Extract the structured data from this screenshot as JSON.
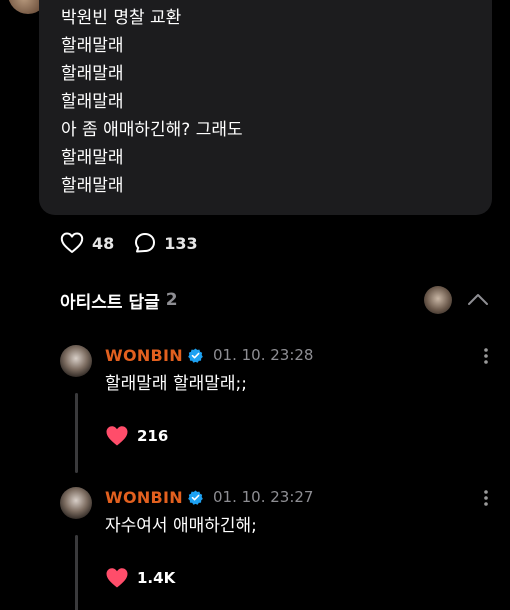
{
  "post": {
    "lines": [
      "박원빈 명찰 교환",
      "할래말래",
      "할래말래",
      "할래말래",
      "아 좀 애매하긴해? 그래도",
      "할래말래",
      "할래말래"
    ],
    "likes": "48",
    "comments": "133"
  },
  "replies_section": {
    "title": "아티스트 답글",
    "count": "2"
  },
  "replies": [
    {
      "author": "WONBIN",
      "timestamp": "01. 10. 23:28",
      "text": "할래말래 할래말래;;",
      "likes": "216"
    },
    {
      "author": "WONBIN",
      "timestamp": "01. 10. 23:27",
      "text": "자수여서 애매하긴해;",
      "likes": "1.4K"
    }
  ],
  "colors": {
    "background": "#000000",
    "bubble": "#1c1c1e",
    "author": "#e2601f",
    "verified": "#1da1f2",
    "heart": "#ff4d6a",
    "muted": "#8e8e93"
  },
  "icons": {
    "like": "heart-outline-icon",
    "comment": "speech-bubble-icon",
    "collapse": "chevron-up-icon",
    "more": "more-vertical-icon",
    "verified": "verified-badge-icon",
    "liked": "heart-filled-icon"
  }
}
